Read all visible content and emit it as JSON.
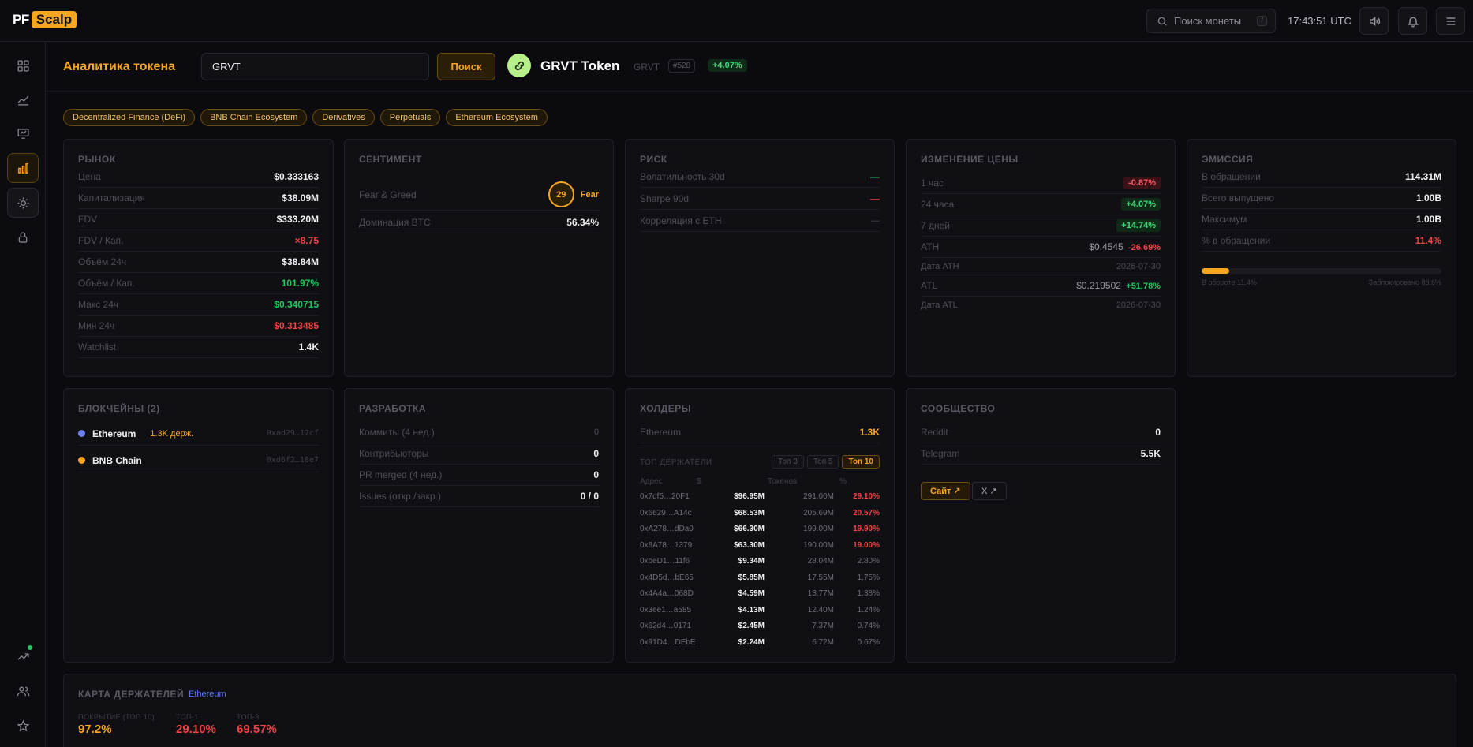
{
  "header": {
    "logo_pf": "PF",
    "logo_scalp": "Scalp",
    "search_placeholder": "Поиск монеты",
    "search_kbd": "/",
    "clock": "17:43:51 UTC"
  },
  "token_bar": {
    "title": "Аналитика токена",
    "input_value": "GRVT",
    "search_label": "Поиск",
    "name": "GRVT Token",
    "symbol": "GRVT",
    "rank": "#528",
    "change": "+4.07%"
  },
  "tags": [
    "Decentralized Finance (DeFi)",
    "BNB Chain Ecosystem",
    "Derivatives",
    "Perpetuals",
    "Ethereum Ecosystem"
  ],
  "market": {
    "title": "РЫНОК",
    "rows": [
      {
        "label": "Цена",
        "value": "$0.333163",
        "tone": ""
      },
      {
        "label": "Капитализация",
        "value": "$38.09M",
        "tone": ""
      },
      {
        "label": "FDV",
        "value": "$333.20M",
        "tone": ""
      },
      {
        "label": "FDV / Кап.",
        "value": "×8.75",
        "tone": "red"
      },
      {
        "label": "Объём 24ч",
        "value": "$38.84M",
        "tone": ""
      },
      {
        "label": "Объём / Кап.",
        "value": "101.97%",
        "tone": "green"
      },
      {
        "label": "Макс 24ч",
        "value": "$0.340715",
        "tone": "green"
      },
      {
        "label": "Мин 24ч",
        "value": "$0.313485",
        "tone": "red"
      },
      {
        "label": "Watchlist",
        "value": "1.4K",
        "tone": ""
      }
    ]
  },
  "sentiment": {
    "title": "СЕНТИМЕНТ",
    "fg_label": "Fear & Greed",
    "fg_value": "29",
    "fg_text": "Fear",
    "btc_label": "Доминация BTC",
    "btc_value": "56.34%"
  },
  "risk": {
    "title": "РИСК",
    "rows": [
      {
        "label": "Волатильность 30d",
        "value": "—",
        "tone": "green"
      },
      {
        "label": "Sharpe 90d",
        "value": "—",
        "tone": "red"
      },
      {
        "label": "Корреляция с ETH",
        "value": "—",
        "tone": "dim"
      }
    ]
  },
  "price_change": {
    "title": "ИЗМЕНЕНИЕ ЦЕНЫ",
    "h1_label": "1 час",
    "h1": "-0.87%",
    "h24_label": "24 часа",
    "h24": "+4.07%",
    "d7_label": "7 дней",
    "d7": "+14.74%",
    "ath_label": "ATH",
    "ath": "$0.4545",
    "ath_chg": "-26.69%",
    "ath_date_label": "Дата ATH",
    "ath_date": "2026-07-30",
    "atl_label": "ATL",
    "atl": "$0.219502",
    "atl_chg": "+51.78%",
    "atl_date_label": "Дата ATL",
    "atl_date": "2026-07-30"
  },
  "emission": {
    "title": "ЭМИССИЯ",
    "rows": [
      {
        "label": "В обращении",
        "value": "114.31M",
        "tone": ""
      },
      {
        "label": "Всего выпущено",
        "value": "1.00B",
        "tone": ""
      },
      {
        "label": "Максимум",
        "value": "1.00B",
        "tone": ""
      },
      {
        "label": "% в обращении",
        "value": "11.4%",
        "tone": "red"
      }
    ],
    "progress_pct": 11.4,
    "circulating_note": "В обороте 11.4%",
    "locked_note": "Заблокировано 88.6%"
  },
  "chains": {
    "title": "БЛОКЧЕЙНЫ (2)",
    "items": [
      {
        "name": "Ethereum",
        "holders": "1.3K держ.",
        "address": "0xad29…17cf",
        "color": "#6b7ff0"
      },
      {
        "name": "BNB Chain",
        "holders": "",
        "address": "0xd6f2…18e7",
        "color": "#f6a623"
      }
    ]
  },
  "development": {
    "title": "РАЗРАБОТКА",
    "rows": [
      {
        "label": "Коммиты (4 нед.)",
        "value": "0",
        "tone": "dim"
      },
      {
        "label": "Контрибьюторы",
        "value": "0",
        "tone": ""
      },
      {
        "label": "PR merged (4 нед.)",
        "value": "0",
        "tone": ""
      },
      {
        "label": "Issues (откр./закр.)",
        "value": "0 / 0",
        "tone": ""
      }
    ]
  },
  "holders": {
    "title": "ХОЛДЕРЫ",
    "chain_label": "Ethereum",
    "chain_value": "1.3K",
    "sub_title": "ТОП ДЕРЖАТЕЛИ",
    "tabs": [
      "Топ 3",
      "Топ 5",
      "Топ 10"
    ],
    "head": {
      "addr": "Адрес",
      "usd": "$",
      "tok": "Токенов",
      "pct": "%"
    },
    "rows": [
      {
        "addr": "0x7df5…20F1",
        "usd": "$96.95M",
        "tok": "291.00M",
        "pct": "29.10%",
        "hot": true
      },
      {
        "addr": "0x6629…A14c",
        "usd": "$68.53M",
        "tok": "205.69M",
        "pct": "20.57%",
        "hot": true
      },
      {
        "addr": "0xA278…dDa0",
        "usd": "$66.30M",
        "tok": "199.00M",
        "pct": "19.90%",
        "hot": true
      },
      {
        "addr": "0x8A78…1379",
        "usd": "$63.30M",
        "tok": "190.00M",
        "pct": "19.00%",
        "hot": true
      },
      {
        "addr": "0xbeD1…11f6",
        "usd": "$9.34M",
        "tok": "28.04M",
        "pct": "2.80%",
        "hot": false
      },
      {
        "addr": "0x4D5d…bE65",
        "usd": "$5.85M",
        "tok": "17.55M",
        "pct": "1.75%",
        "hot": false
      },
      {
        "addr": "0x4A4a…068D",
        "usd": "$4.59M",
        "tok": "13.77M",
        "pct": "1.38%",
        "hot": false
      },
      {
        "addr": "0x3ee1…a585",
        "usd": "$4.13M",
        "tok": "12.40M",
        "pct": "1.24%",
        "hot": false
      },
      {
        "addr": "0x62d4…0171",
        "usd": "$2.45M",
        "tok": "7.37M",
        "pct": "0.74%",
        "hot": false
      },
      {
        "addr": "0x91D4…DEbE",
        "usd": "$2.24M",
        "tok": "6.72M",
        "pct": "0.67%",
        "hot": false
      }
    ]
  },
  "community": {
    "title": "СООБЩЕСТВО",
    "rows": [
      {
        "label": "Reddit",
        "value": "0",
        "tone": ""
      },
      {
        "label": "Telegram",
        "value": "5.5K",
        "tone": ""
      }
    ],
    "site_label": "Сайт ↗",
    "x_label": "X ↗"
  },
  "holder_map": {
    "title": "КАРТА ДЕРЖАТЕЛЕЙ",
    "chain": "Ethereum",
    "stats": [
      {
        "label": "ПОКРЫТИЕ (ТОП 10)",
        "value": "97.2%",
        "tone": "orange"
      },
      {
        "label": "ТОП-1",
        "value": "29.10%",
        "tone": "red"
      },
      {
        "label": "ТОП-3",
        "value": "69.57%",
        "tone": "red"
      }
    ]
  }
}
